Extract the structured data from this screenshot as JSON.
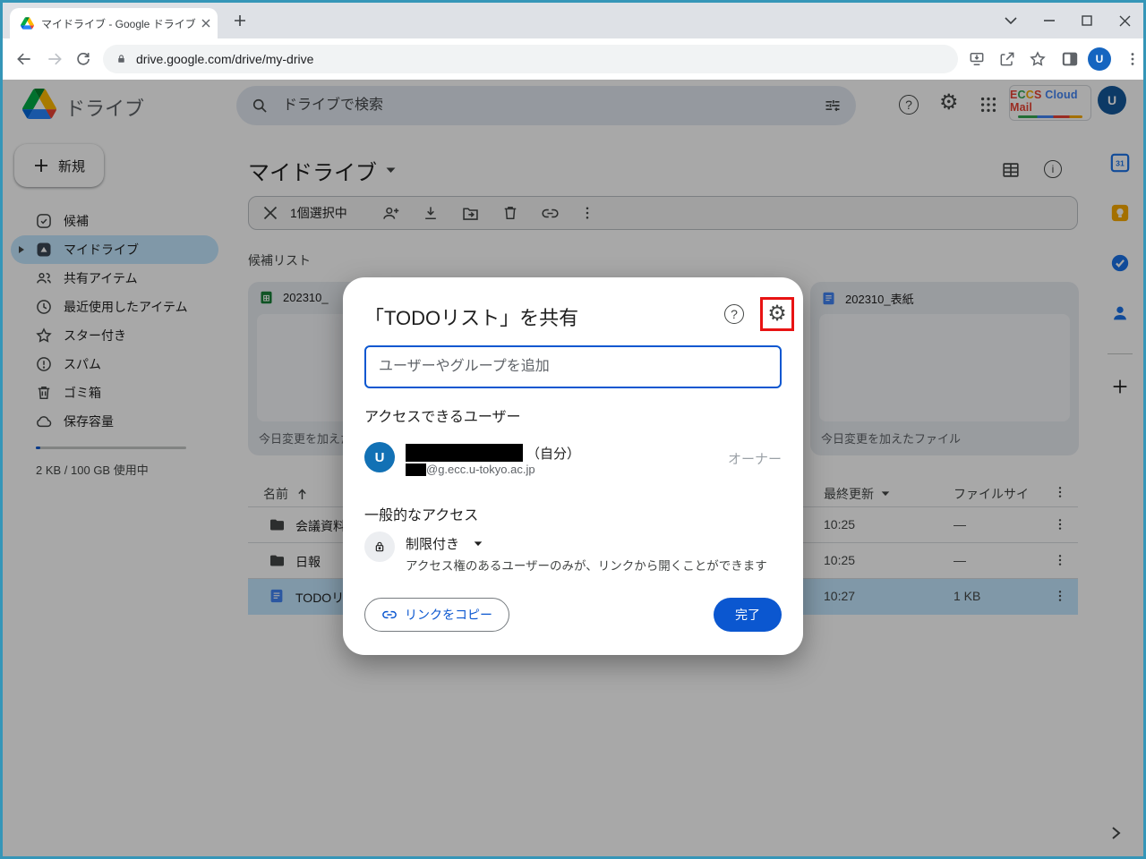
{
  "browser": {
    "tab_title": "マイドライブ - Google ドライブ",
    "url": "drive.google.com/drive/my-drive",
    "avatar_letter": "U"
  },
  "header": {
    "app_name": "ドライブ",
    "search_placeholder": "ドライブで検索",
    "badge": {
      "e": "E",
      "c1": "C",
      "c2": "C",
      "s": "S",
      "cloud": "Cloud",
      "mail": "Mail"
    },
    "avatar_letter": "U"
  },
  "sidebar": {
    "new_button": "新規",
    "items": [
      {
        "label": "候補"
      },
      {
        "label": "マイドライブ"
      },
      {
        "label": "共有アイテム"
      },
      {
        "label": "最近使用したアイテム"
      },
      {
        "label": "スター付き"
      },
      {
        "label": "スパム"
      },
      {
        "label": "ゴミ箱"
      },
      {
        "label": "保存容量"
      }
    ],
    "storage_text": "2 KB / 100 GB 使用中"
  },
  "main": {
    "title": "マイドライブ",
    "selection_count": "1個選択中",
    "suggestions_label": "候補リスト",
    "cards": [
      {
        "name": "202310_",
        "caption": "今日変更を加えた"
      },
      {
        "name": "202310_表紙",
        "caption": "今日変更を加えたファイル"
      }
    ],
    "table": {
      "name_header": "名前",
      "modified_header": "最終更新",
      "size_header": "ファイルサイ",
      "rows": [
        {
          "name": "会議資料",
          "modified": "10:25",
          "size": "—"
        },
        {
          "name": "日報",
          "modified": "10:25",
          "size": "—"
        },
        {
          "name": "TODOリ",
          "modified": "10:27",
          "size": "1 KB"
        }
      ]
    }
  },
  "dialog": {
    "title": "「TODOリスト」を共有",
    "input_placeholder": "ユーザーやグループを追加",
    "access_heading": "アクセスできるユーザー",
    "owner": {
      "avatar_letter": "U",
      "self_label": "（自分）",
      "email_suffix": "@g.ecc.u-tokyo.ac.jp",
      "role": "オーナー"
    },
    "general_heading": "一般的なアクセス",
    "restricted_label": "制限付き",
    "restricted_desc": "アクセス権のあるユーザーのみが、リンクから開くことができます",
    "copy_link_label": "リンクをコピー",
    "done_label": "完了"
  },
  "colors": {
    "accent_blue": "#0b57d0",
    "selected_row": "#c2e7ff",
    "highlight_red": "#e81313",
    "window_border": "#3596b8",
    "dim_overlay": "rgba(0,0,0,0.34)"
  }
}
